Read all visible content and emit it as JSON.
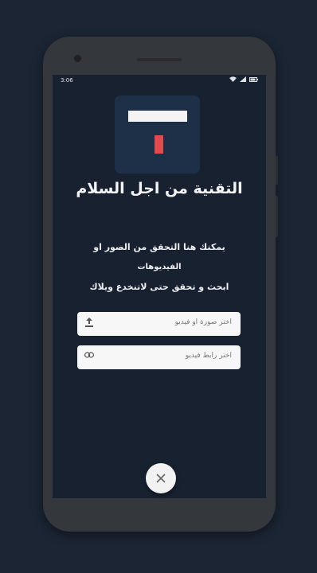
{
  "statusbar": {
    "time": "3:06",
    "signal_icon": "signal-icon",
    "wifi_icon": "wifi-icon",
    "battery_icon": "battery-icon"
  },
  "app": {
    "title": "التقنية من اجل السلام",
    "description_line1": "يمكنك هنا التحقق من الصور او",
    "description_line2": "الفيديوهات",
    "description_line3": "ابحث و تحقق حتى لاتنخدع ويلاك"
  },
  "fields": {
    "image_or_video_placeholder": "اختر صورة او فيديو",
    "video_link_placeholder": "اختر رابط فيديو"
  },
  "icons": {
    "upload": "upload-icon",
    "link": "link-icon",
    "close": "close-icon"
  },
  "colors": {
    "background": "#1b2534",
    "screen": "#172130",
    "logo_tile": "#1d3047",
    "logo_accent": "#e24a4b"
  }
}
